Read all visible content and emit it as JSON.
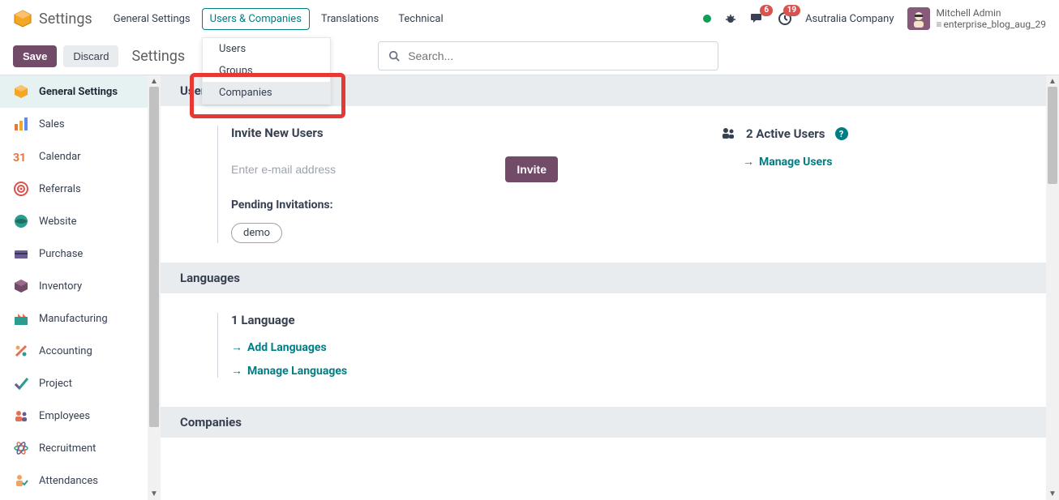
{
  "header": {
    "app_title": "Settings",
    "menus": [
      "General Settings",
      "Users & Companies",
      "Translations",
      "Technical"
    ],
    "chat_badge": "6",
    "activity_badge": "19",
    "company": "Asutralia Company",
    "user_name": "Mitchell Admin",
    "db_name": "enterprise_blog_aug_29"
  },
  "dropdown": {
    "items": [
      "Users",
      "Groups",
      "Companies"
    ]
  },
  "actions": {
    "save": "Save",
    "discard": "Discard",
    "page_title": "Settings",
    "search_placeholder": "Search..."
  },
  "sidebar": {
    "items": [
      {
        "label": "General Settings"
      },
      {
        "label": "Sales"
      },
      {
        "label": "Calendar"
      },
      {
        "label": "Referrals"
      },
      {
        "label": "Website"
      },
      {
        "label": "Purchase"
      },
      {
        "label": "Inventory"
      },
      {
        "label": "Manufacturing"
      },
      {
        "label": "Accounting"
      },
      {
        "label": "Project"
      },
      {
        "label": "Employees"
      },
      {
        "label": "Recruitment"
      },
      {
        "label": "Attendances"
      }
    ]
  },
  "sections": {
    "users": {
      "title": "Users",
      "invite_title": "Invite New Users",
      "email_placeholder": "Enter e-mail address",
      "invite_btn": "Invite",
      "pending_label": "Pending Invitations:",
      "pending_tag": "demo",
      "active_users": "2 Active Users",
      "manage_users": "Manage Users"
    },
    "languages": {
      "title": "Languages",
      "count": "1 Language",
      "add": "Add Languages",
      "manage": "Manage Languages"
    },
    "companies": {
      "title": "Companies"
    }
  }
}
